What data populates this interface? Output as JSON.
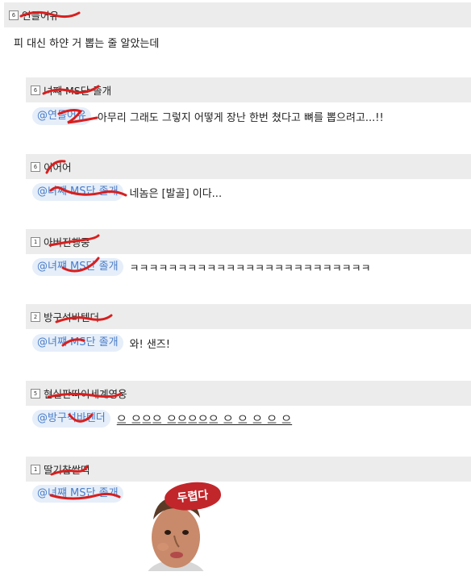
{
  "comments": [
    {
      "level": "6",
      "nickname": "연들어유",
      "text": "피 대신 하얀 거 뽑는 줄 알았는데"
    },
    {
      "level": "6",
      "nickname": "녀쨰 MS단 졸개",
      "mention": "@연들어유",
      "text": "아무리 그래도 그렇지 어떻게 장난 한번 쳤다고 뼈를 뽑으려고...!!"
    },
    {
      "level": "6",
      "nickname": "이어어",
      "mention": "@녀쨰 MS단 졸개",
      "text": "네놈은 [발골] 이다..."
    },
    {
      "level": "1",
      "nickname": "아버진행중",
      "mention": "@녀쨰 MS단 졸개",
      "text": "ㅋㅋㅋㅋㅋㅋㅋㅋㅋㅋㅋㅋㅋㅋㅋㅋㅋㅋㅋㅋㅋㅋㅋㅋㅋ"
    },
    {
      "level": "2",
      "nickname": "방구석바텐더",
      "mention": "@녀쨰 MS단 졸개",
      "text": "와! 샌즈!"
    },
    {
      "level": "5",
      "nickname": "현실판따이세계영웅",
      "mention": "@방구석바텐더",
      "text": "으 으으으 으으으으으 으 으 으 으 으"
    },
    {
      "level": "1",
      "nickname": "딸기찹쌀떡",
      "mention": "@녀쨰 MS단 졸개",
      "sticker_text": "두렵다"
    }
  ],
  "colors": {
    "scribble": "#d81f1f",
    "mention_bg": "#e5eef9",
    "mention_fg": "#4a7cc8",
    "bar": "#ececec"
  }
}
